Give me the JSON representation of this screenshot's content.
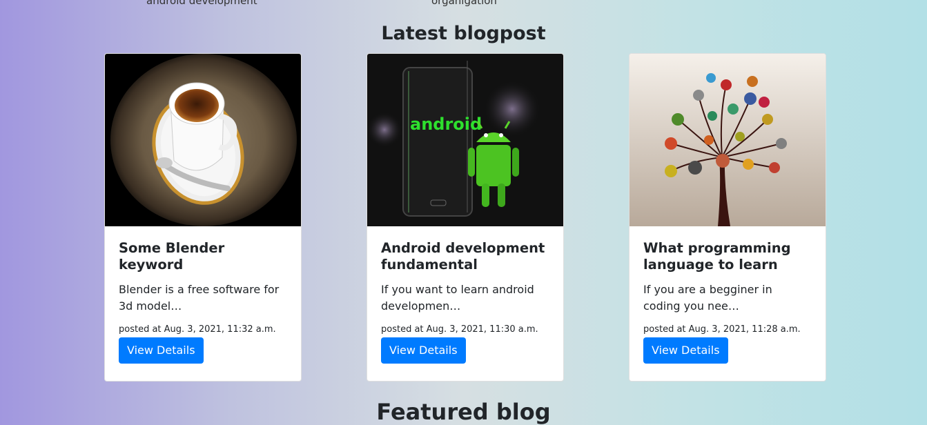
{
  "top": {
    "left_text": "android development",
    "center_text": "organigation"
  },
  "latest": {
    "title": "Latest blogpost"
  },
  "featured": {
    "title": "Featured blog"
  },
  "posts": [
    {
      "title": "Some Blender keyword",
      "excerpt": "Blender is a free software for 3d model…",
      "meta": "posted at Aug. 3, 2021, 11:32 a.m.",
      "button": "View Details",
      "image": "coffee-cup-image"
    },
    {
      "title": "Android development fundamental",
      "excerpt": "If you want to learn android developmen…",
      "meta": "posted at Aug. 3, 2021, 11:30 a.m.",
      "button": "View Details",
      "image": "android-robot-image",
      "image_text": "android"
    },
    {
      "title": "What programming language to learn",
      "excerpt": "If you are a begginer in coding you nee…",
      "meta": "posted at Aug. 3, 2021, 11:28 a.m.",
      "button": "View Details",
      "image": "social-media-tree-image"
    }
  ],
  "colors": {
    "button": "#007bff",
    "gradient_left": "#a197df",
    "gradient_right": "#b2e0e6"
  }
}
